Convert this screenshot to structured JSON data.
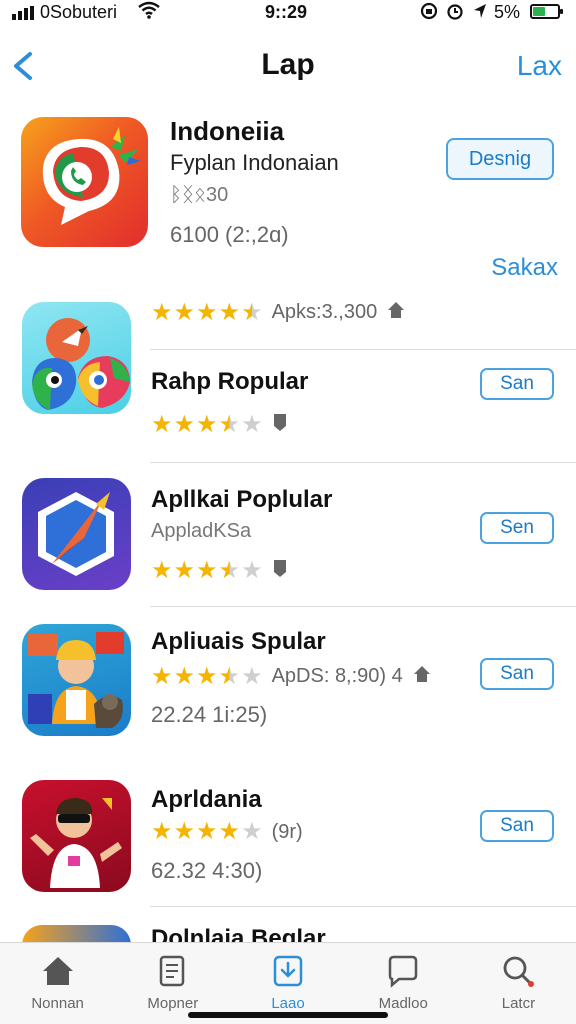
{
  "status_bar": {
    "carrier": "0Sobuteri",
    "time": "9::29",
    "battery_percent": "5%",
    "battery_level": 0.55
  },
  "nav": {
    "title": "Lap",
    "right_action": "Lax"
  },
  "featured": {
    "name": "Indoneiia",
    "subtitle": "Fyplan Indonaian",
    "meta": "ᛒᛝᛟ30",
    "date": "6100 (2:,2ɑ)",
    "get_label": "Desnig",
    "see_all": "Sakax"
  },
  "items": [
    {
      "name": "",
      "rating": 4.5,
      "rating_text": "Apks:3.,300",
      "has_home_icon": true,
      "action_label": ""
    },
    {
      "name": "Rahp Ropular",
      "rating": 3.5,
      "rating_text": "",
      "action_label": "San"
    },
    {
      "name": "Apllkai Poplular",
      "subtitle": "AppladKSa",
      "rating": 3.5,
      "action_label": "Sen"
    },
    {
      "name": "Apliuais Spular",
      "rating": 3.5,
      "rating_text": "ApDS: 8,:90) 4",
      "date": "22.24 1i:25)",
      "action_label": "San"
    },
    {
      "name": "Aprldania",
      "rating": 4.0,
      "rating_text": "(9r)",
      "date": "62.32 4:30)",
      "action_label": "San"
    },
    {
      "name": "Dolnlaia Beglar"
    }
  ],
  "tabs": [
    {
      "label": "Nonnan",
      "icon": "house-icon"
    },
    {
      "label": "Mopner",
      "icon": "document-icon"
    },
    {
      "label": "Laao",
      "icon": "download-icon",
      "active": true
    },
    {
      "label": "Madloo",
      "icon": "chat-bubble-icon"
    },
    {
      "label": "Latcr",
      "icon": "search-icon"
    }
  ],
  "colors": {
    "accent": "#2a8fd8",
    "star": "#f5b400",
    "battery": "#2bb24c"
  }
}
